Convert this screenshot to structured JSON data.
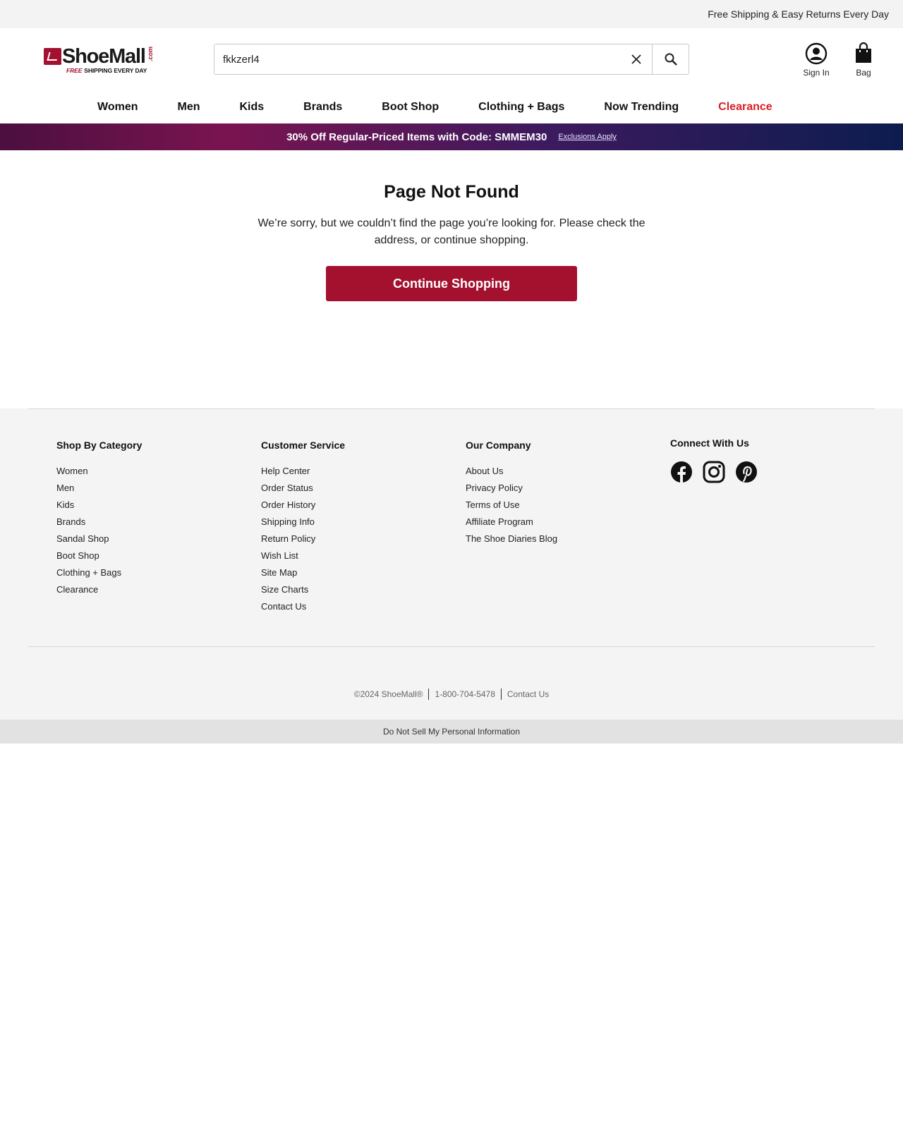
{
  "topbar": {
    "message": "Free Shipping & Easy Returns Every Day"
  },
  "logo": {
    "text": "ShoeMall",
    "suffix": ".com",
    "tagline_free": "FREE",
    "tagline_rest": "SHIPPING EVERY DAY"
  },
  "search": {
    "value": "fkkzerl4",
    "clear_icon": "close-icon",
    "submit_icon": "search-icon"
  },
  "account": {
    "sign_in_label": "Sign In",
    "bag_label": "Bag"
  },
  "nav": {
    "items": [
      {
        "label": "Women"
      },
      {
        "label": "Men"
      },
      {
        "label": "Kids"
      },
      {
        "label": "Brands"
      },
      {
        "label": "Boot Shop"
      },
      {
        "label": "Clothing + Bags"
      },
      {
        "label": "Now Trending"
      },
      {
        "label": "Clearance"
      }
    ]
  },
  "promo": {
    "text": "30% Off Regular-Priced Items with Code: SMMEM30",
    "link": "Exclusions Apply"
  },
  "main": {
    "title": "Page Not Found",
    "message": "We’re sorry, but we couldn’t find the page you’re looking for. Please check the address, or continue shopping.",
    "cta": "Continue Shopping"
  },
  "footer": {
    "shop_by_category": {
      "heading": "Shop By Category",
      "links": [
        "Women",
        "Men",
        "Kids",
        "Brands",
        "Sandal Shop",
        "Boot Shop",
        "Clothing + Bags",
        "Clearance"
      ]
    },
    "customer_service": {
      "heading": "Customer Service",
      "links": [
        "Help Center",
        "Order Status",
        "Order History",
        "Shipping Info",
        "Return Policy",
        "Wish List",
        "Site Map",
        "Size Charts",
        "Contact Us"
      ]
    },
    "our_company": {
      "heading": "Our Company",
      "links": [
        "About Us",
        "Privacy Policy",
        "Terms of Use",
        "Affiliate Program",
        "The Shoe Diaries Blog"
      ]
    },
    "connect": {
      "heading": "Connect With Us",
      "icons": [
        "facebook-icon",
        "instagram-icon",
        "pinterest-icon"
      ]
    },
    "copyright": "©2024 ShoeMall®",
    "phone": "1-800-704-5478",
    "contact": "Contact Us",
    "do_not_sell": "Do Not Sell My Personal Information"
  },
  "colors": {
    "brand": "#a3112f",
    "clearance": "#d81f26",
    "promo_start": "#4b0f3f",
    "promo_end": "#0c1c4f"
  }
}
